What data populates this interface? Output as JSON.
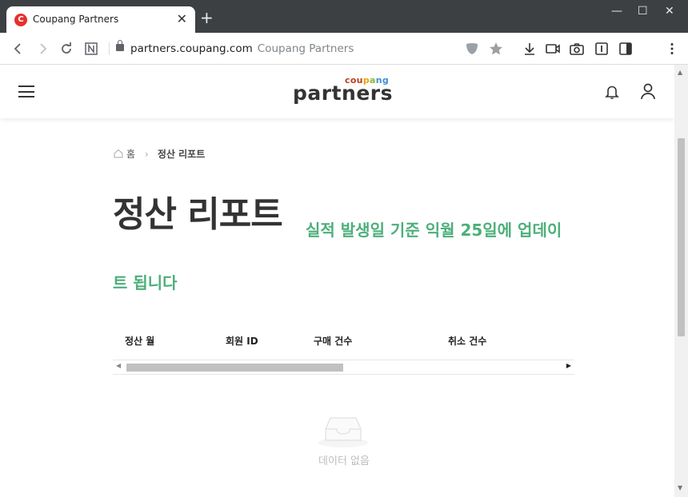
{
  "browser": {
    "tab_title": "Coupang Partners",
    "tab_favicon_letter": "C",
    "url_host": "partners.coupang.com",
    "url_page_title": "Coupang Partners"
  },
  "header": {
    "logo_small": "coupang",
    "logo_main": "partners"
  },
  "breadcrumb": {
    "home": "홈",
    "current": "정산 리포트"
  },
  "page": {
    "title": "정산 리포트",
    "subtitle": "실적 발생일 기준 익월 25일에 업데이트 됩니다"
  },
  "table": {
    "columns": [
      "정산 월",
      "회원 ID",
      "구매 건수",
      "취소 건수"
    ],
    "empty_text": "데이터 없음"
  },
  "colors": {
    "accent_green": "#4caf7a",
    "favicon_red": "#e4312e"
  }
}
